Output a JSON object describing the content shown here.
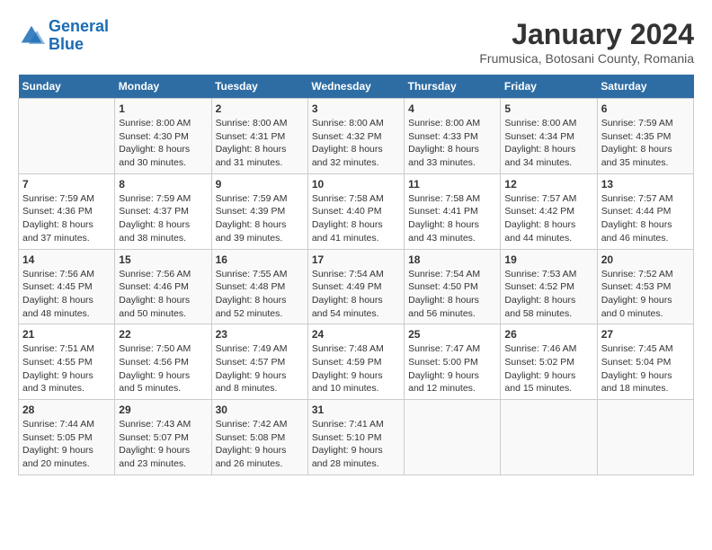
{
  "logo": {
    "line1": "General",
    "line2": "Blue"
  },
  "title": "January 2024",
  "subtitle": "Frumusica, Botosani County, Romania",
  "days_of_week": [
    "Sunday",
    "Monday",
    "Tuesday",
    "Wednesday",
    "Thursday",
    "Friday",
    "Saturday"
  ],
  "weeks": [
    [
      {
        "day": "",
        "sunrise": "",
        "sunset": "",
        "daylight": ""
      },
      {
        "day": "1",
        "sunrise": "Sunrise: 8:00 AM",
        "sunset": "Sunset: 4:30 PM",
        "daylight": "Daylight: 8 hours and 30 minutes."
      },
      {
        "day": "2",
        "sunrise": "Sunrise: 8:00 AM",
        "sunset": "Sunset: 4:31 PM",
        "daylight": "Daylight: 8 hours and 31 minutes."
      },
      {
        "day": "3",
        "sunrise": "Sunrise: 8:00 AM",
        "sunset": "Sunset: 4:32 PM",
        "daylight": "Daylight: 8 hours and 32 minutes."
      },
      {
        "day": "4",
        "sunrise": "Sunrise: 8:00 AM",
        "sunset": "Sunset: 4:33 PM",
        "daylight": "Daylight: 8 hours and 33 minutes."
      },
      {
        "day": "5",
        "sunrise": "Sunrise: 8:00 AM",
        "sunset": "Sunset: 4:34 PM",
        "daylight": "Daylight: 8 hours and 34 minutes."
      },
      {
        "day": "6",
        "sunrise": "Sunrise: 7:59 AM",
        "sunset": "Sunset: 4:35 PM",
        "daylight": "Daylight: 8 hours and 35 minutes."
      }
    ],
    [
      {
        "day": "7",
        "sunrise": "Sunrise: 7:59 AM",
        "sunset": "Sunset: 4:36 PM",
        "daylight": "Daylight: 8 hours and 37 minutes."
      },
      {
        "day": "8",
        "sunrise": "Sunrise: 7:59 AM",
        "sunset": "Sunset: 4:37 PM",
        "daylight": "Daylight: 8 hours and 38 minutes."
      },
      {
        "day": "9",
        "sunrise": "Sunrise: 7:59 AM",
        "sunset": "Sunset: 4:39 PM",
        "daylight": "Daylight: 8 hours and 39 minutes."
      },
      {
        "day": "10",
        "sunrise": "Sunrise: 7:58 AM",
        "sunset": "Sunset: 4:40 PM",
        "daylight": "Daylight: 8 hours and 41 minutes."
      },
      {
        "day": "11",
        "sunrise": "Sunrise: 7:58 AM",
        "sunset": "Sunset: 4:41 PM",
        "daylight": "Daylight: 8 hours and 43 minutes."
      },
      {
        "day": "12",
        "sunrise": "Sunrise: 7:57 AM",
        "sunset": "Sunset: 4:42 PM",
        "daylight": "Daylight: 8 hours and 44 minutes."
      },
      {
        "day": "13",
        "sunrise": "Sunrise: 7:57 AM",
        "sunset": "Sunset: 4:44 PM",
        "daylight": "Daylight: 8 hours and 46 minutes."
      }
    ],
    [
      {
        "day": "14",
        "sunrise": "Sunrise: 7:56 AM",
        "sunset": "Sunset: 4:45 PM",
        "daylight": "Daylight: 8 hours and 48 minutes."
      },
      {
        "day": "15",
        "sunrise": "Sunrise: 7:56 AM",
        "sunset": "Sunset: 4:46 PM",
        "daylight": "Daylight: 8 hours and 50 minutes."
      },
      {
        "day": "16",
        "sunrise": "Sunrise: 7:55 AM",
        "sunset": "Sunset: 4:48 PM",
        "daylight": "Daylight: 8 hours and 52 minutes."
      },
      {
        "day": "17",
        "sunrise": "Sunrise: 7:54 AM",
        "sunset": "Sunset: 4:49 PM",
        "daylight": "Daylight: 8 hours and 54 minutes."
      },
      {
        "day": "18",
        "sunrise": "Sunrise: 7:54 AM",
        "sunset": "Sunset: 4:50 PM",
        "daylight": "Daylight: 8 hours and 56 minutes."
      },
      {
        "day": "19",
        "sunrise": "Sunrise: 7:53 AM",
        "sunset": "Sunset: 4:52 PM",
        "daylight": "Daylight: 8 hours and 58 minutes."
      },
      {
        "day": "20",
        "sunrise": "Sunrise: 7:52 AM",
        "sunset": "Sunset: 4:53 PM",
        "daylight": "Daylight: 9 hours and 0 minutes."
      }
    ],
    [
      {
        "day": "21",
        "sunrise": "Sunrise: 7:51 AM",
        "sunset": "Sunset: 4:55 PM",
        "daylight": "Daylight: 9 hours and 3 minutes."
      },
      {
        "day": "22",
        "sunrise": "Sunrise: 7:50 AM",
        "sunset": "Sunset: 4:56 PM",
        "daylight": "Daylight: 9 hours and 5 minutes."
      },
      {
        "day": "23",
        "sunrise": "Sunrise: 7:49 AM",
        "sunset": "Sunset: 4:57 PM",
        "daylight": "Daylight: 9 hours and 8 minutes."
      },
      {
        "day": "24",
        "sunrise": "Sunrise: 7:48 AM",
        "sunset": "Sunset: 4:59 PM",
        "daylight": "Daylight: 9 hours and 10 minutes."
      },
      {
        "day": "25",
        "sunrise": "Sunrise: 7:47 AM",
        "sunset": "Sunset: 5:00 PM",
        "daylight": "Daylight: 9 hours and 12 minutes."
      },
      {
        "day": "26",
        "sunrise": "Sunrise: 7:46 AM",
        "sunset": "Sunset: 5:02 PM",
        "daylight": "Daylight: 9 hours and 15 minutes."
      },
      {
        "day": "27",
        "sunrise": "Sunrise: 7:45 AM",
        "sunset": "Sunset: 5:04 PM",
        "daylight": "Daylight: 9 hours and 18 minutes."
      }
    ],
    [
      {
        "day": "28",
        "sunrise": "Sunrise: 7:44 AM",
        "sunset": "Sunset: 5:05 PM",
        "daylight": "Daylight: 9 hours and 20 minutes."
      },
      {
        "day": "29",
        "sunrise": "Sunrise: 7:43 AM",
        "sunset": "Sunset: 5:07 PM",
        "daylight": "Daylight: 9 hours and 23 minutes."
      },
      {
        "day": "30",
        "sunrise": "Sunrise: 7:42 AM",
        "sunset": "Sunset: 5:08 PM",
        "daylight": "Daylight: 9 hours and 26 minutes."
      },
      {
        "day": "31",
        "sunrise": "Sunrise: 7:41 AM",
        "sunset": "Sunset: 5:10 PM",
        "daylight": "Daylight: 9 hours and 28 minutes."
      },
      {
        "day": "",
        "sunrise": "",
        "sunset": "",
        "daylight": ""
      },
      {
        "day": "",
        "sunrise": "",
        "sunset": "",
        "daylight": ""
      },
      {
        "day": "",
        "sunrise": "",
        "sunset": "",
        "daylight": ""
      }
    ]
  ]
}
